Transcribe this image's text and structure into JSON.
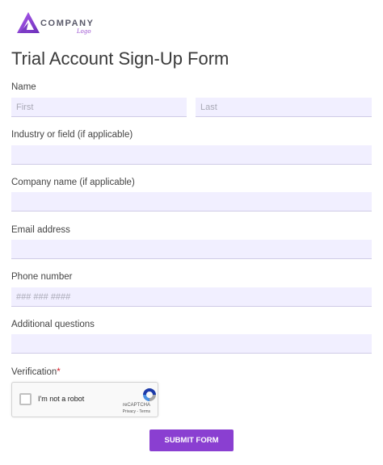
{
  "logo": {
    "company": "COMPANY",
    "sub": "Logo"
  },
  "form": {
    "title": "Trial Account Sign-Up Form",
    "name_label": "Name",
    "first_placeholder": "First",
    "last_placeholder": "Last",
    "industry_label": "Industry or field (if applicable)",
    "company_label": "Company name (if applicable)",
    "email_label": "Email address",
    "phone_label": "Phone number",
    "phone_placeholder": "### ### ####",
    "additional_label": "Additional questions",
    "verification_label": "Verification",
    "required_mark": "*",
    "submit_label": "SUBMIT FORM"
  },
  "captcha": {
    "text": "I'm not a robot",
    "brand": "reCAPTCHA",
    "links": "Privacy - Terms"
  },
  "colors": {
    "accent": "#8a3fd1",
    "field_bg": "#f1efff",
    "required": "#d6202a"
  }
}
